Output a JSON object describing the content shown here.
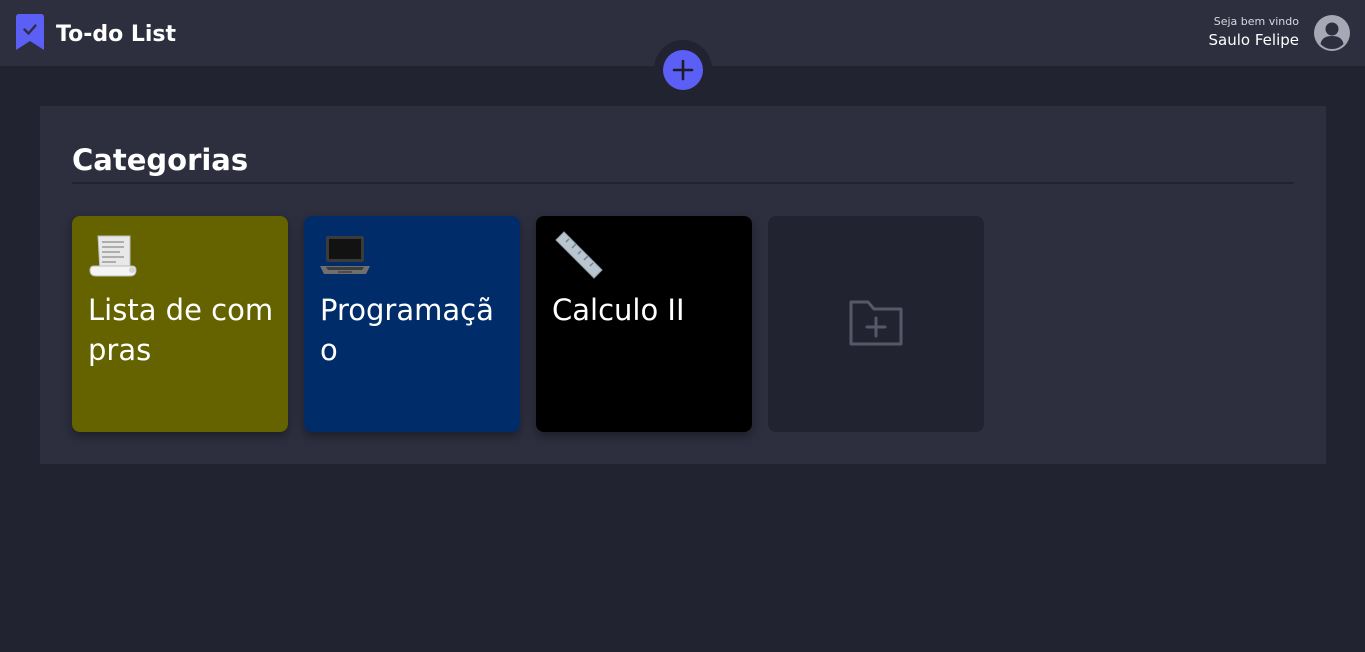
{
  "header": {
    "app_title": "To-do List",
    "welcome": "Seja bem vindo",
    "user_name": "Saulo Felipe",
    "logo_icon": "bookmark-check-icon",
    "avatar_icon": "user-circle-icon"
  },
  "add_button": {
    "icon": "plus-icon"
  },
  "main": {
    "title": "Categorias",
    "categories": [
      {
        "label": "Lista de compras",
        "icon": "receipt-scroll-icon",
        "color": "#646300"
      },
      {
        "label": "Programação",
        "icon": "laptop-icon",
        "color": "#002d69"
      },
      {
        "label": "Calculo II",
        "icon": "ruler-icon",
        "color": "#000000"
      }
    ],
    "new_category_icon": "folder-plus-icon"
  },
  "colors": {
    "background": "#222331",
    "surface": "#2d2e3e",
    "accent": "#5b5ff5"
  }
}
